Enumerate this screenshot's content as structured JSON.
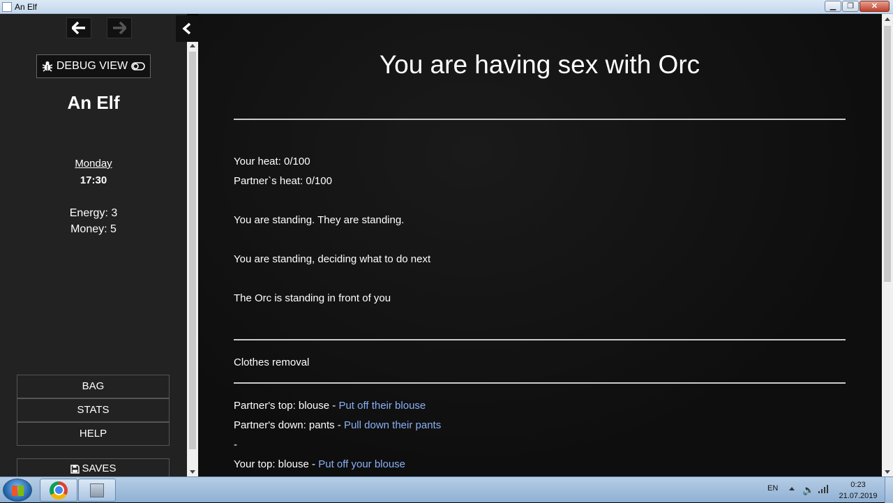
{
  "window": {
    "title": "An Elf",
    "close_label": "✕"
  },
  "sidebar": {
    "debug_label": "DEBUG VIEW",
    "story_title": "An Elf",
    "day": "Monday",
    "time": "17:30",
    "energy": "Energy: 3",
    "money": "Money: 5",
    "menu": {
      "bag": "BAG",
      "stats": "STATS",
      "help": "HELP",
      "saves": "SAVES"
    }
  },
  "passage": {
    "title": "You are having sex with Orc",
    "heat": "Your heat: 0/100",
    "partner_heat": "Partner`s heat: 0/100",
    "standing": "You are standing. They are standing.",
    "deciding": "You are standing, deciding what to do next",
    "orc_position": "The Orc is standing in front of you",
    "section_title": "Clothes removal",
    "partner_top": {
      "label": "Partner's top: blouse",
      "sep": " - ",
      "action": "Put off their blouse"
    },
    "partner_down": {
      "label": "Partner's down: pants",
      "sep": " - ",
      "action": "Pull down their pants"
    },
    "dash": "-",
    "your_top": {
      "label": "Your top: blouse",
      "sep": " - ",
      "action": "Put off your blouse"
    }
  },
  "taskbar": {
    "language": "EN",
    "time": "0:23",
    "date": "21.07.2019"
  },
  "colors": {
    "link": "#8ab0f5",
    "sidebar_bg": "#222222",
    "main_bg": "#111111"
  }
}
